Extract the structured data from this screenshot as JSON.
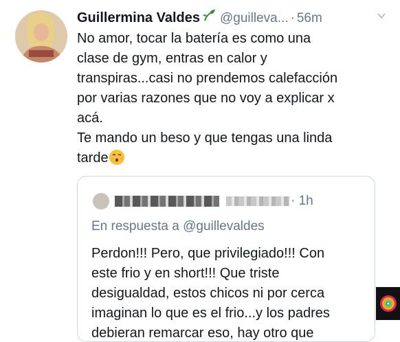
{
  "tweet": {
    "name": "Guillermina Valdes",
    "handle": "@guilleva...",
    "separator": "·",
    "time": "56m",
    "lines": [
      "No amor, tocar la batería es como una",
      "clase de gym, entras en calor y",
      "transpiras...casi no prendemos calefacción",
      "por varias razones que no voy a explicar x",
      "acá.",
      "Te mando un beso y que tengas una linda"
    ],
    "last_line": "tarde",
    "icons": {
      "sprout": "sprout-emoji",
      "emoji": "kissing-face-emoji",
      "menu": "chevron-down-icon"
    }
  },
  "quoted": {
    "time_suffix": "· 1h",
    "reply_to": "En respuesta a @guillevaldes",
    "lines": [
      "Perdon!!! Pero, que privilegiado!!! Con",
      "este frio y en short!!! Que triste",
      "desigualdad, estos chicos ni por cerca",
      "imaginan lo que es el frio...y los padres",
      "debieran remarcar eso, hay otro que"
    ]
  },
  "colors": {
    "text": "#14171a",
    "muted": "#657786",
    "border": "#ccd6dd",
    "sprout": "#3a8c3a",
    "emoji": "#f7c23a"
  }
}
